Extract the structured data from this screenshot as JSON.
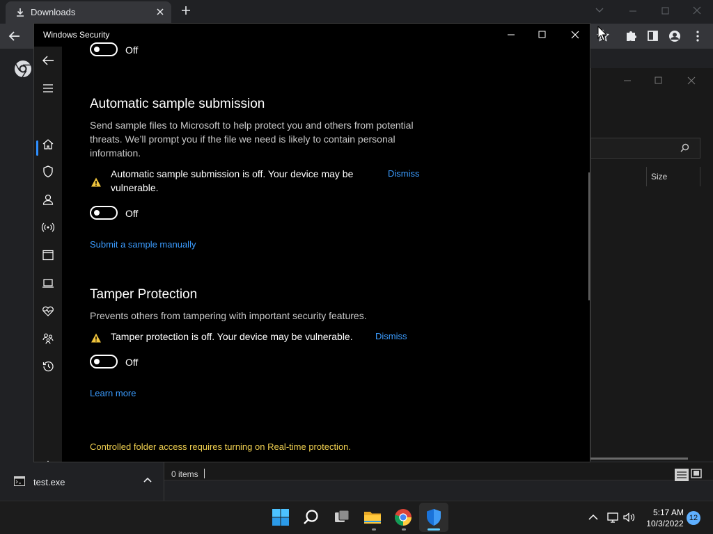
{
  "chrome": {
    "tab_title": "Downloads",
    "download_file": "test.exe",
    "explorer_size_header": "Size",
    "items_count": "0 items"
  },
  "ws": {
    "window_title": "Windows Security",
    "top_toggle_state": "Off",
    "sample": {
      "title": "Automatic sample submission",
      "description": "Send sample files to Microsoft to help protect you and others from potential threats. We’ll prompt you if the file we need is likely to contain personal information.",
      "warning": "Automatic sample submission is off. Your device may be vulnerable.",
      "dismiss": "Dismiss",
      "toggle_state": "Off",
      "submit_link": "Submit a sample manually"
    },
    "tamper": {
      "title": "Tamper Protection",
      "description": "Prevents others from tampering with important security features.",
      "warning": "Tamper protection is off. Your device may be vulnerable.",
      "dismiss": "Dismiss",
      "toggle_state": "Off",
      "learn_link": "Learn more"
    },
    "controlled_folder": "Controlled folder access requires turning on Real-time protection.",
    "nav_icons": [
      "back-arrow-icon",
      "hamburger-icon",
      "home-icon",
      "shield-icon",
      "person-icon",
      "wifi-antenna-icon",
      "browser-window-icon",
      "laptop-icon",
      "heart-pulse-icon",
      "family-icon",
      "history-icon",
      "settings-gear-icon"
    ]
  },
  "taskbar": {
    "time": "5:17 AM",
    "date": "10/3/2022",
    "notification_count": "12"
  },
  "colors": {
    "accent_link": "#3b9cff",
    "warning_yellow": "#f0c43c",
    "info_text_yellow": "#f0d050",
    "window_bg": "#000000"
  }
}
